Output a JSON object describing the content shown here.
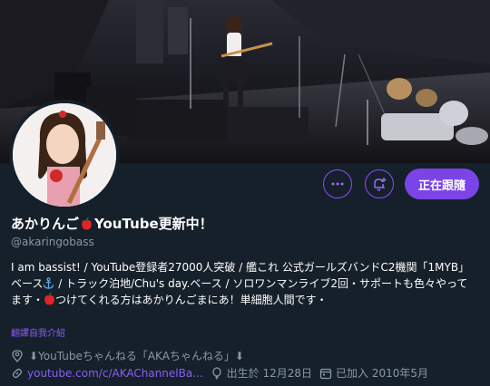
{
  "profile": {
    "display_name": "あかりんご",
    "display_name_suffix": "YouTube更新中！",
    "handle": "@akaringobass",
    "bio_part1": "I am bassist! / YouTube登録者27000人突破 / 艦これ 公式ガールズバンドC2機関「1MYB」ベース",
    "bio_part2": " / トラック泊地/Chu's day.ベース / ソロワンマンライブ2回・サポートも色々やってます・",
    "bio_part3": "つけてくれる方はあかりんごまにあ！単細胞人間です・",
    "translate_label": "翻譯自我介紹",
    "location": "⬇YouTubeちゃんねる「AKAちゃんねる」⬇",
    "website": "youtube.com/c/AKAChannelBa...",
    "birthday": "出生於 12月28日",
    "joined": "已加入 2010年5月"
  },
  "actions": {
    "more_icon": "more-dots-icon",
    "notify_icon": "bell-plus-icon",
    "follow_label": "正在跟隨"
  },
  "colors": {
    "background": "#15202b",
    "accent": "#7a44e6",
    "link": "#8b5cf6",
    "muted": "#8899a6"
  }
}
